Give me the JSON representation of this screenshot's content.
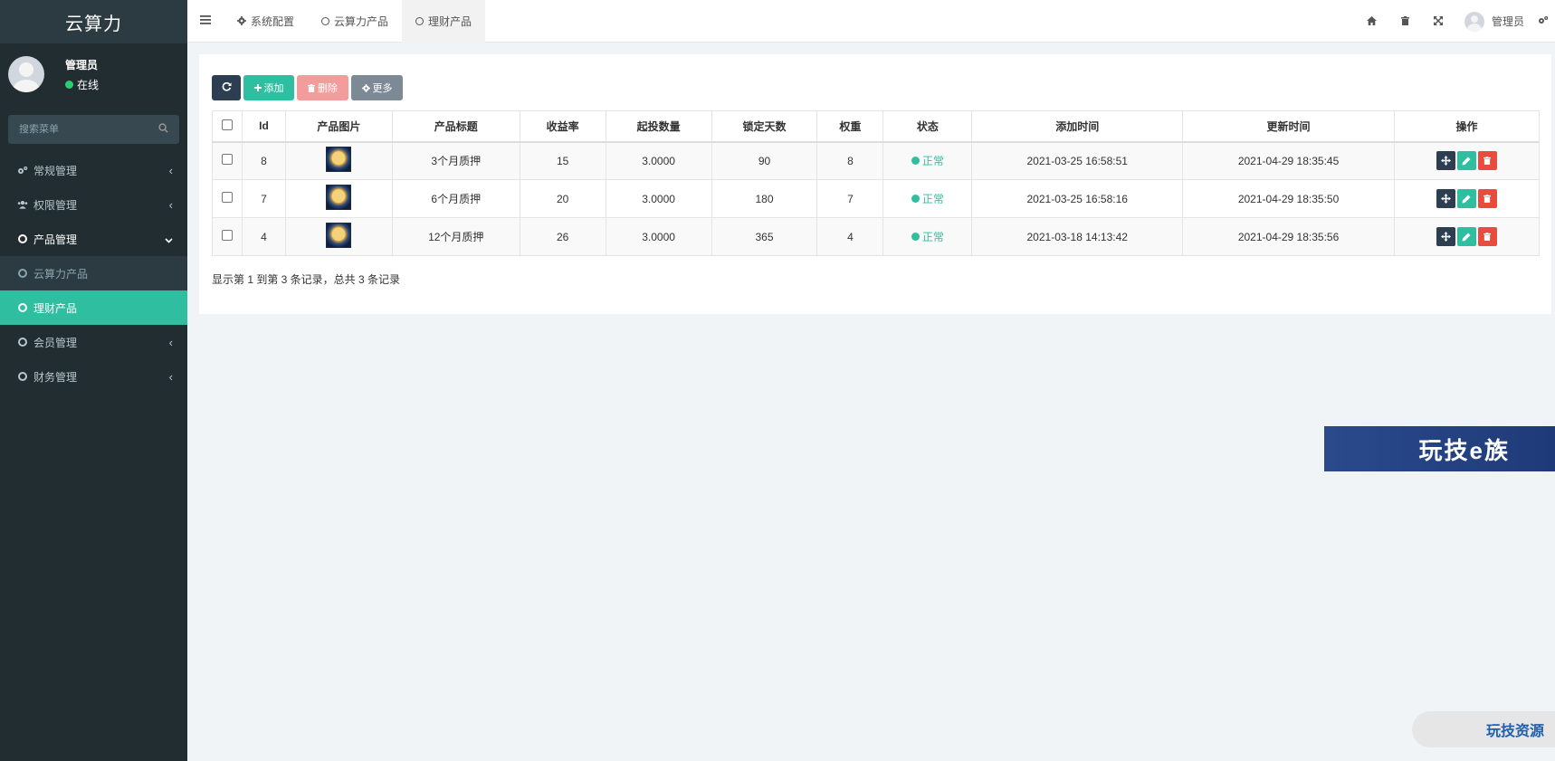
{
  "sidebar": {
    "brand": "云算力",
    "user": {
      "name": "管理员",
      "status": "在线"
    },
    "search_placeholder": "搜索菜单",
    "menu": {
      "general": "常规管理",
      "permission": "权限管理",
      "product": "产品管理",
      "cloud_power": "云算力产品",
      "finance_product": "理财产品",
      "member": "会员管理",
      "finance": "财务管理"
    }
  },
  "topnav": {
    "tabs": {
      "system_config": "系统配置",
      "cloud_power": "云算力产品",
      "finance_product": "理财产品"
    },
    "user_name": "管理员"
  },
  "toolbar": {
    "add": "添加",
    "delete": "删除",
    "more": "更多"
  },
  "table": {
    "headers": {
      "id": "Id",
      "image": "产品图片",
      "title": "产品标题",
      "rate": "收益率",
      "min_amount": "起投数量",
      "lock_days": "锁定天数",
      "weight": "权重",
      "status": "状态",
      "created": "添加时间",
      "updated": "更新时间",
      "ops": "操作"
    },
    "rows": [
      {
        "id": "8",
        "title": "3个月质押",
        "rate": "15",
        "min_amount": "3.0000",
        "lock_days": "90",
        "weight": "8",
        "status": "正常",
        "created": "2021-03-25 16:58:51",
        "updated": "2021-04-29 18:35:45"
      },
      {
        "id": "7",
        "title": "6个月质押",
        "rate": "20",
        "min_amount": "3.0000",
        "lock_days": "180",
        "weight": "7",
        "status": "正常",
        "created": "2021-03-25 16:58:16",
        "updated": "2021-04-29 18:35:50"
      },
      {
        "id": "4",
        "title": "12个月质押",
        "rate": "26",
        "min_amount": "3.0000",
        "lock_days": "365",
        "weight": "4",
        "status": "正常",
        "created": "2021-03-18 14:13:42",
        "updated": "2021-04-29 18:35:56"
      }
    ],
    "summary": "显示第 1 到第 3 条记录，总共 3 条记录"
  },
  "watermarks": {
    "banner": "玩技e族",
    "corner": "玩技资源"
  },
  "colors": {
    "accent": "#2fbfa0",
    "sidebar_bg": "#222d32",
    "danger": "#e74c3c",
    "dark": "#2c3e50"
  }
}
